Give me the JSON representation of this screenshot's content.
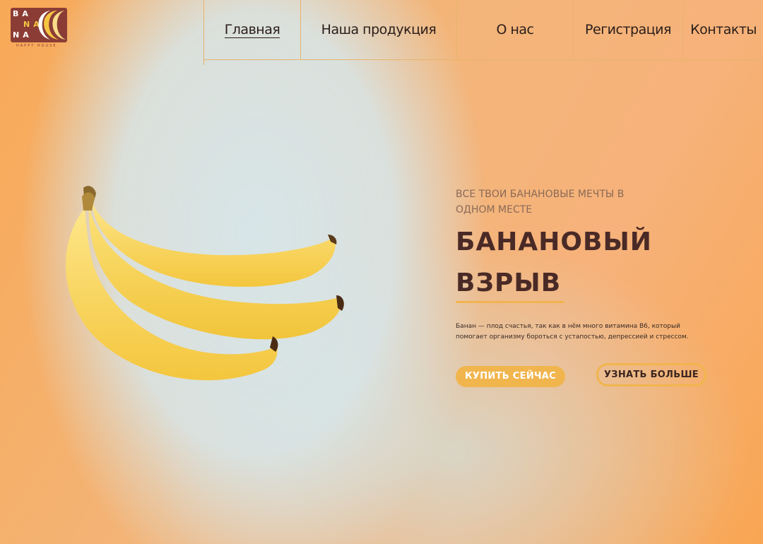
{
  "logo": {
    "line1": "BA",
    "line2": "NA",
    "line3": "NA",
    "tagline": "HAPPY HOUSE"
  },
  "nav": {
    "items": [
      {
        "label": "Главная",
        "active": true
      },
      {
        "label": "Наша продукция",
        "active": false
      },
      {
        "label": "О нас",
        "active": false
      },
      {
        "label": "Регистрация",
        "active": false
      },
      {
        "label": "Контакты",
        "active": false
      }
    ]
  },
  "hero": {
    "subtitle": "ВСЕ ТВОИ БАНАНОВЫЕ МЕЧТЫ В ОДНОМ МЕСТЕ",
    "title": "БАНАНОВЫЙ ВЗРЫВ",
    "description": "Банан — плод счастья, так как в нём много витамина B6, который помогает организму бороться с устапостью, депрессией и стрессом.",
    "buy_button": "КУПИТЬ СЕЙЧАС",
    "more_button": "УЗНАТЬ БОЛЬШЕ"
  },
  "colors": {
    "accent": "#f1b54e",
    "brand_dark": "#8b3d35",
    "title": "#4a2a26",
    "background_orange": "#f8a957",
    "background_mint": "#d6e8ee"
  },
  "icons": {
    "logo_mark": "banana-crescent-icon",
    "hero_image": "banana-bunch-image"
  }
}
